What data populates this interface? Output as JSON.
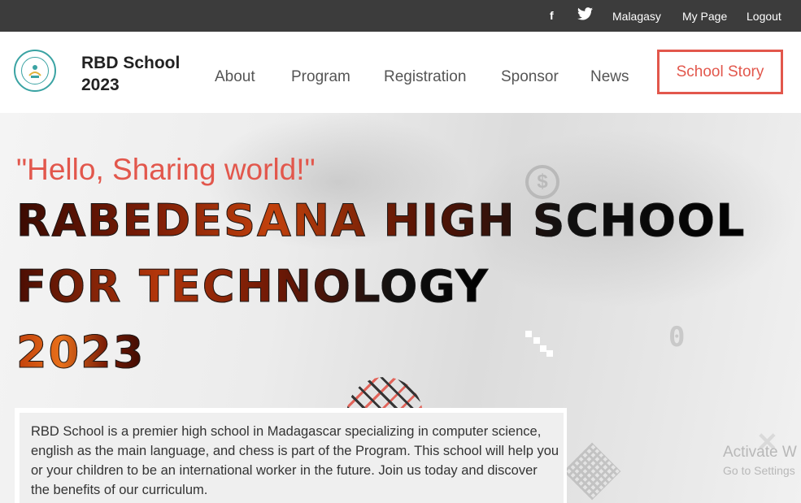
{
  "topbar": {
    "facebook_icon": "facebook-icon",
    "twitter_icon": "twitter-icon",
    "links": [
      "Malagasy",
      "My Page",
      "Logout"
    ]
  },
  "header": {
    "brand_line1": "RBD School",
    "brand_line2": "2023",
    "nav": [
      "About",
      "Program",
      "Registration",
      "Sponsor",
      "News"
    ],
    "cta": "School Story"
  },
  "hero": {
    "greeting": "\"Hello, Sharing world!\"",
    "title_line1": "RABEDESANA HIGH SCHOOL",
    "title_line2": "FOR TECHNOLOGY",
    "title_line3": "2023",
    "description": "RBD School is a premier high school in Madagascar specializing in computer science, english as the main language, and chess is part of the Program. This school will help you or your children to be an international worker in the future. Join us today and discover the benefits of our curriculum.",
    "decor_zero": "0"
  },
  "os_watermark": {
    "line1": "Activate W",
    "line2": "Go to Settings"
  },
  "colors": {
    "accent": "#e2574c",
    "topbar_bg": "#3c3c3c"
  }
}
